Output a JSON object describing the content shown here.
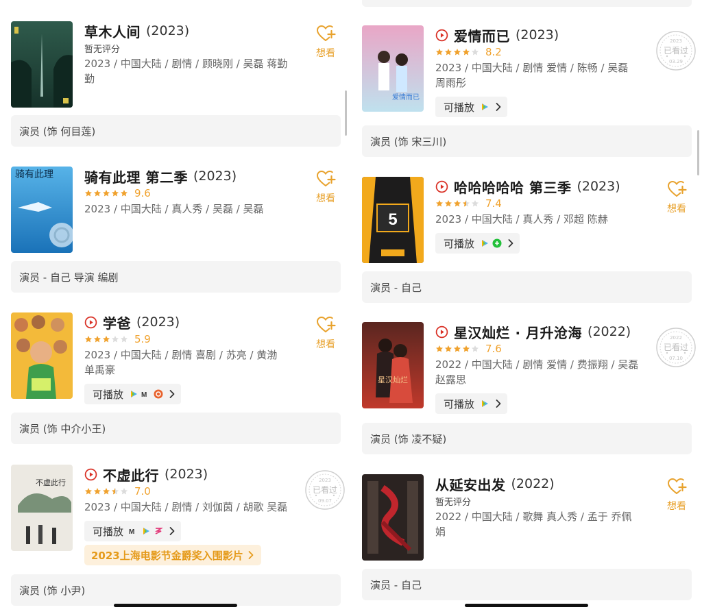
{
  "colors": {
    "accent_orange": "#f0a22e",
    "play_red": "#d93025",
    "card_grey": "#f4f4f4",
    "text_meta": "#666666"
  },
  "common": {
    "wish_label": "想看",
    "playable_label": "可播放",
    "no_rating": "暂无评分"
  },
  "left": {
    "movies": [
      {
        "title": "草木人间",
        "year": "(2023)",
        "rating_text": "暂无评分",
        "meta": "2023 / 中国大陆 / 剧情 / 顾晓刚 / 吴磊 蒋勤勤",
        "role": "演员 (饰 何目莲)",
        "wish": "想看"
      },
      {
        "title": "骑有此理 第二季",
        "year": "(2023)",
        "stars": 5,
        "score": "9.6",
        "meta": "2023 / 中国大陆 / 真人秀 / 吴磊 / 吴磊",
        "role": "演员 - 自己 导演 编剧",
        "wish": "想看"
      },
      {
        "title": "学爸",
        "year": "(2023)",
        "stars": 3,
        "score": "5.9",
        "meta": "2023 / 中国大陆 / 剧情 喜剧 / 苏亮 / 黄渤 单禹豪",
        "playable": "可播放",
        "role": "演员 (饰 中介小王)",
        "wish": "想看"
      },
      {
        "title": "不虚此行",
        "year": "(2023)",
        "stars": 3.5,
        "score": "7.0",
        "meta": "2023 / 中国大陆 / 剧情 / 刘伽茵 / 胡歌 吴磊",
        "playable": "可播放",
        "award": "2023上海电影节金爵奖入围影片",
        "role": "演员 (饰 小尹)",
        "stamp": {
          "year": "2023",
          "label": "已看过",
          "date": "09.07"
        }
      }
    ]
  },
  "right": {
    "movies": [
      {
        "title": "爱情而已",
        "year": "(2023)",
        "stars": 4,
        "score": "8.2",
        "meta": "2023 / 中国大陆 / 剧情 爱情 / 陈畅 / 吴磊 周雨彤",
        "playable": "可播放",
        "role": "演员 (饰 宋三川)",
        "stamp": {
          "year": "2023",
          "label": "已看过",
          "date": "03.29"
        }
      },
      {
        "title": "哈哈哈哈哈 第三季",
        "year": "(2023)",
        "stars": 3.5,
        "score": "7.4",
        "meta": "2023 / 中国大陆 / 真人秀 / 邓超 陈赫",
        "playable": "可播放",
        "role": "演员 - 自己",
        "wish": "想看"
      },
      {
        "title": "星汉灿烂 · 月升沧海",
        "year": "(2022)",
        "stars": 4,
        "score": "7.6",
        "meta": "2022 / 中国大陆 / 剧情 爱情 / 费振翔 / 吴磊 赵露思",
        "playable": "可播放",
        "role": "演员 (饰 凌不疑)",
        "stamp": {
          "year": "2022",
          "label": "已看过",
          "date": "07.10"
        }
      },
      {
        "title": "从延安出发",
        "year": "(2022)",
        "rating_text": "暂无评分",
        "meta": "2022 / 中国大陆 / 歌舞 真人秀 / 孟于 乔佩娟",
        "role": "演员 - 自己",
        "wish": "想看"
      }
    ]
  }
}
